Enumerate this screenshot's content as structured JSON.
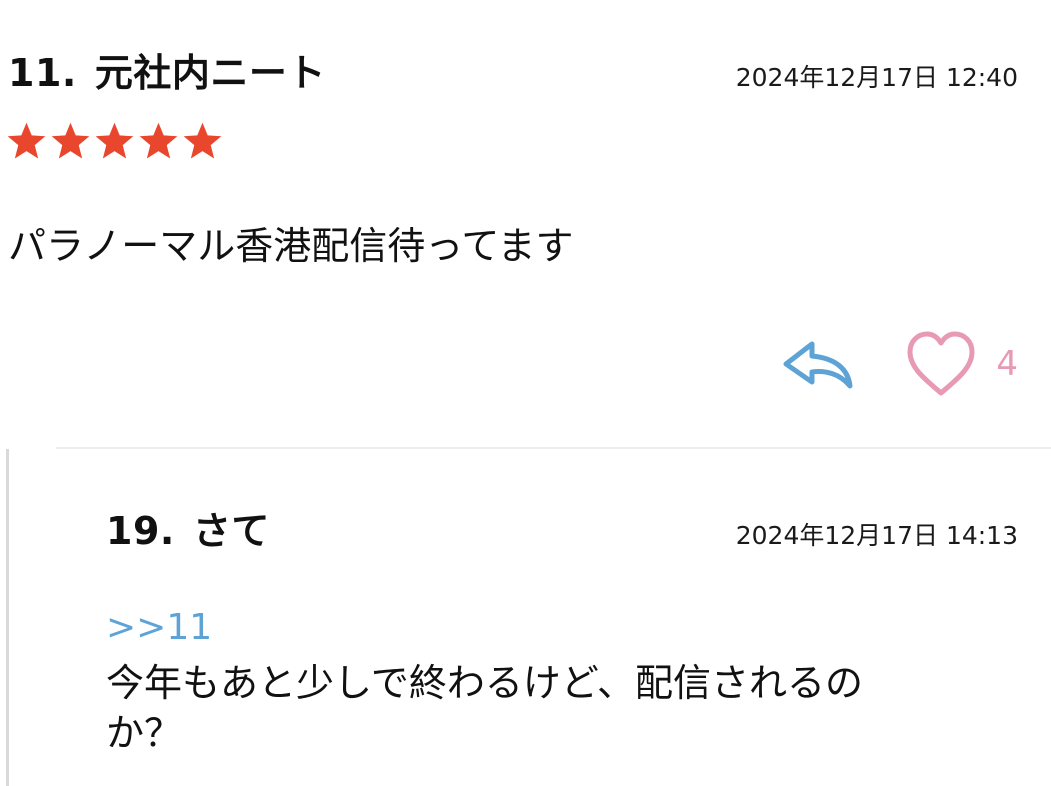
{
  "comment": {
    "number": "11.",
    "author": "元社内ニート",
    "timestamp": "2024年12月17日 12:40",
    "rating": 5,
    "rating_color": "#e8472d",
    "body": "パラノーマル香港配信待ってます",
    "like_count": "4",
    "reply_icon": "reply-arrow-icon",
    "like_icon": "heart-icon",
    "reply_icon_color": "#5ea3d6",
    "like_icon_color": "#e899b3"
  },
  "reply": {
    "number": "19.",
    "author": "さて",
    "timestamp": "2024年12月17日 14:13",
    "anchor": ">>11",
    "body_line1": "今年もあと少しで終わるけど、配信されるの",
    "body_line2": "か？",
    "anchor_color": "#5ea3d6"
  }
}
